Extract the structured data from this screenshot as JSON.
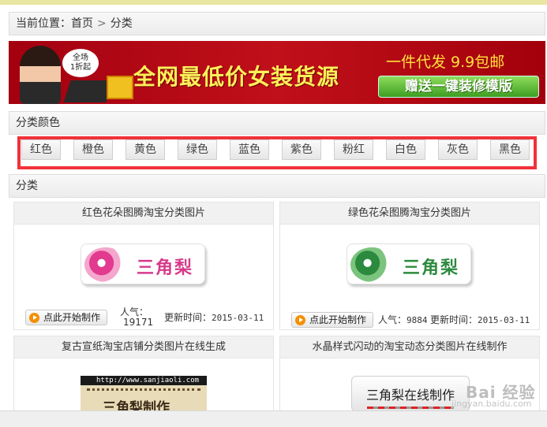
{
  "breadcrumb": {
    "label": "当前位置：",
    "home": "首页",
    "separator": ">",
    "current": "分类"
  },
  "banner": {
    "bubble_line1": "全场",
    "bubble_line2": "1折起",
    "main_text": "全网最低价女装货源",
    "sub_text": "一件代发 9.9包邮",
    "button_text": "赠送一键装修模版"
  },
  "color_section": {
    "title": "分类颜色",
    "colors": [
      "红色",
      "橙色",
      "黄色",
      "绿色",
      "蓝色",
      "紫色",
      "粉红",
      "白色",
      "灰色",
      "黑色"
    ]
  },
  "category_section": {
    "title": "分类"
  },
  "cards": [
    {
      "title": "红色花朵图腾淘宝分类图片",
      "image_text": "三角梨",
      "button": "点此开始制作",
      "popularity_label": "人气：",
      "popularity": "19171",
      "updated_label": "更新时间：",
      "updated": "2015-03-11",
      "accent": "#d63a8a"
    },
    {
      "title": "绿色花朵图腾淘宝分类图片",
      "image_text": "三角梨",
      "button": "点此开始制作",
      "popularity_label": "人气：",
      "popularity": "9884",
      "updated_label": "更新时间：",
      "updated": "2015-03-11",
      "accent": "#2c8a3e"
    },
    {
      "title": "复古宣纸淘宝店铺分类图片在线生成",
      "image_url_text": "http://www.sanjiaoli.com",
      "image_text": "三角梨制作"
    },
    {
      "title": "水晶样式闪动的淘宝动态分类图片在线制作",
      "image_text": "三角梨在线制作"
    }
  ],
  "watermark": {
    "brand": "Bai 经验",
    "url": "jingyan.baidu.com"
  }
}
